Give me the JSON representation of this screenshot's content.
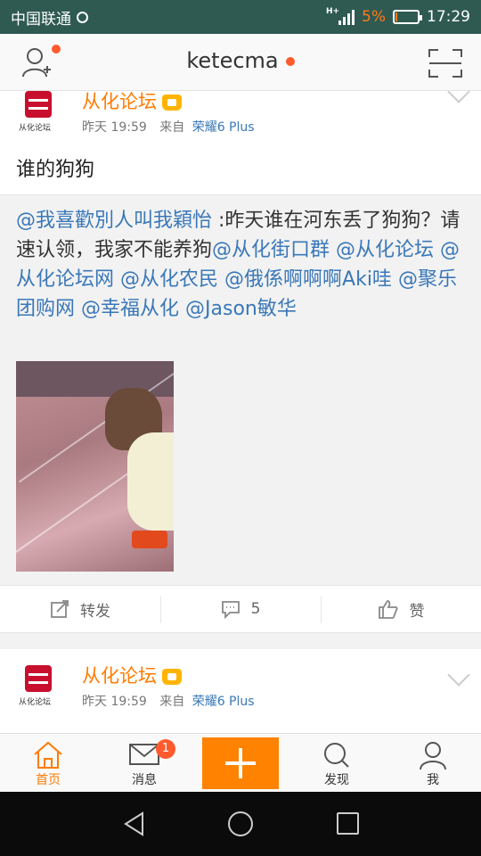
{
  "status_bar": {
    "carrier": "中国联通",
    "network": "H+",
    "battery_pct": "5%",
    "battery_level": 0.05,
    "time": "17:29"
  },
  "navbar": {
    "title": "ketecma",
    "left_icon": "add-friend-icon",
    "right_icon": "scan-icon"
  },
  "post1": {
    "user": "从化论坛",
    "avatar_caption": "从化论坛",
    "time": "昨天 19:59",
    "from_label": "来自",
    "source": "荣耀6 Plus",
    "text": "谁的狗狗",
    "forwarded": {
      "parts": [
        {
          "t": "@我喜歡別人叫我穎怡",
          "m": true
        },
        {
          "t": " :昨天谁在河东丢了狗狗？请速认领，我家不能养狗",
          "m": false
        },
        {
          "t": "@从化街口群",
          "m": true
        },
        {
          "t": " ",
          "m": false
        },
        {
          "t": "@从化论坛",
          "m": true
        },
        {
          "t": " ",
          "m": false
        },
        {
          "t": "@从化论坛网",
          "m": true
        },
        {
          "t": " ",
          "m": false
        },
        {
          "t": "@从化农民",
          "m": true
        },
        {
          "t": " ",
          "m": false
        },
        {
          "t": "@俄係啊啊啊Aki哇",
          "m": true
        },
        {
          "t": " ",
          "m": false
        },
        {
          "t": "@聚乐团购网",
          "m": true
        },
        {
          "t": " ",
          "m": false
        },
        {
          "t": "@幸福从化",
          "m": true
        },
        {
          "t": " ",
          "m": false
        },
        {
          "t": "@Jason敏华",
          "m": true
        }
      ]
    },
    "actions": {
      "repost": "转发",
      "comments": "5",
      "like": "赞"
    }
  },
  "post2": {
    "user": "从化论坛",
    "avatar_caption": "从化论坛",
    "time": "昨天 19:59",
    "from_label": "来自",
    "source": "荣耀6 Plus"
  },
  "tabbar": {
    "home": "首页",
    "messages": "消息",
    "messages_badge": "1",
    "discover": "发现",
    "me": "我"
  },
  "colors": {
    "accent": "#ff8200",
    "link": "#3a78b8",
    "badge": "#ff5a2e"
  }
}
